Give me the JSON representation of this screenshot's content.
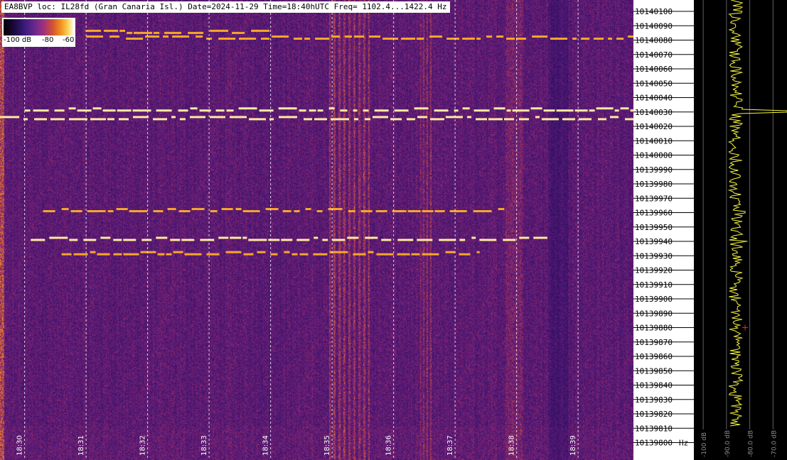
{
  "header": {
    "text": "EA8BVP loc: IL28fd (Gran Canaria Isl.) Date=2024-11-29 Time=18:40hUTC Freq= 1102.4...1422.4 Hz"
  },
  "colorbar": {
    "labels": [
      "-100 dB",
      "-80",
      "-60"
    ]
  },
  "freq_axis": {
    "unit": "Hz"
  },
  "spectrum_axis": {
    "labels": [
      "-100 dB",
      "-90.0 dB",
      "-80.0 dB",
      "-70.0 dB"
    ]
  },
  "colors": {
    "background": "#2a0d52",
    "signal_hot": "#ffe9a0",
    "signal": "#f6a62a",
    "spectrum_line": "#f5f542",
    "marker": "#ff2020"
  },
  "chart_data": [
    {
      "type": "heatmap",
      "title": "EA8BVP loc: IL28fd (Gran Canaria Isl.) Date=2024-11-29 Time=18:40hUTC Freq= 1102.4...1422.4 Hz",
      "xlabel": "",
      "ylabel": "Hz",
      "x_ticks": [
        "18:30",
        "18:31",
        "18:32",
        "18:33",
        "18:34",
        "18:35",
        "18:36",
        "18:37",
        "18:38",
        "18:39"
      ],
      "y_ticks": [
        10140100,
        10140090,
        10140080,
        10140070,
        10140060,
        10140050,
        10140040,
        10140030,
        10140020,
        10140010,
        10140000,
        10139990,
        10139980,
        10139970,
        10139960,
        10139950,
        10139940,
        10139930,
        10139920,
        10139910,
        10139900,
        10139890,
        10139880,
        10139870,
        10139860,
        10139850,
        10139840,
        10139830,
        10139820,
        10139810,
        10139800
      ],
      "xlim": [
        "18:29.6",
        "18:39.9"
      ],
      "ylim": [
        10139795,
        10140105
      ],
      "colorbar": {
        "range_db": [
          -100,
          -60
        ],
        "labels": [
          "-100 dB",
          "-80",
          "-60"
        ]
      },
      "grid": "x only (dashed white)",
      "traces": [
        {
          "start": "18:30.0",
          "end": "18:39.9",
          "freq_hz": 10140031,
          "level_db": -62
        },
        {
          "start": "18:29.6",
          "end": "18:39.9",
          "freq_hz": 10140025,
          "level_db": -63
        },
        {
          "start": "18:31.0",
          "end": "18:39.9",
          "freq_hz": 10140081,
          "level_db": -66
        },
        {
          "start": "18:31.0",
          "end": "18:34.0",
          "freq_hz": 10140085,
          "level_db": -67
        },
        {
          "start": "18:30.1",
          "end": "18:38.5",
          "freq_hz": 10139941,
          "level_db": -62
        },
        {
          "start": "18:30.3",
          "end": "18:37.8",
          "freq_hz": 10139961,
          "level_db": -65
        },
        {
          "start": "18:30.6",
          "end": "18:37.4",
          "freq_hz": 10139931,
          "level_db": -66
        }
      ]
    },
    {
      "type": "line",
      "xlabel": "",
      "ylabel": "",
      "x_ticks": [
        "-100 dB",
        "-90.0 dB",
        "-80.0 dB",
        "-70.0 dB"
      ],
      "xlim": [
        -104,
        -64
      ],
      "ylim": [
        10139795,
        10140105
      ],
      "peaks": [
        {
          "freq_hz": 10140030,
          "level_db": -64
        },
        {
          "freq_hz": 10139940,
          "level_db": -81
        },
        {
          "freq_hz": 10139960,
          "level_db": -82
        }
      ],
      "baseline_db": -86,
      "marker": {
        "freq_hz": 10139880,
        "level_db": -82
      }
    }
  ]
}
